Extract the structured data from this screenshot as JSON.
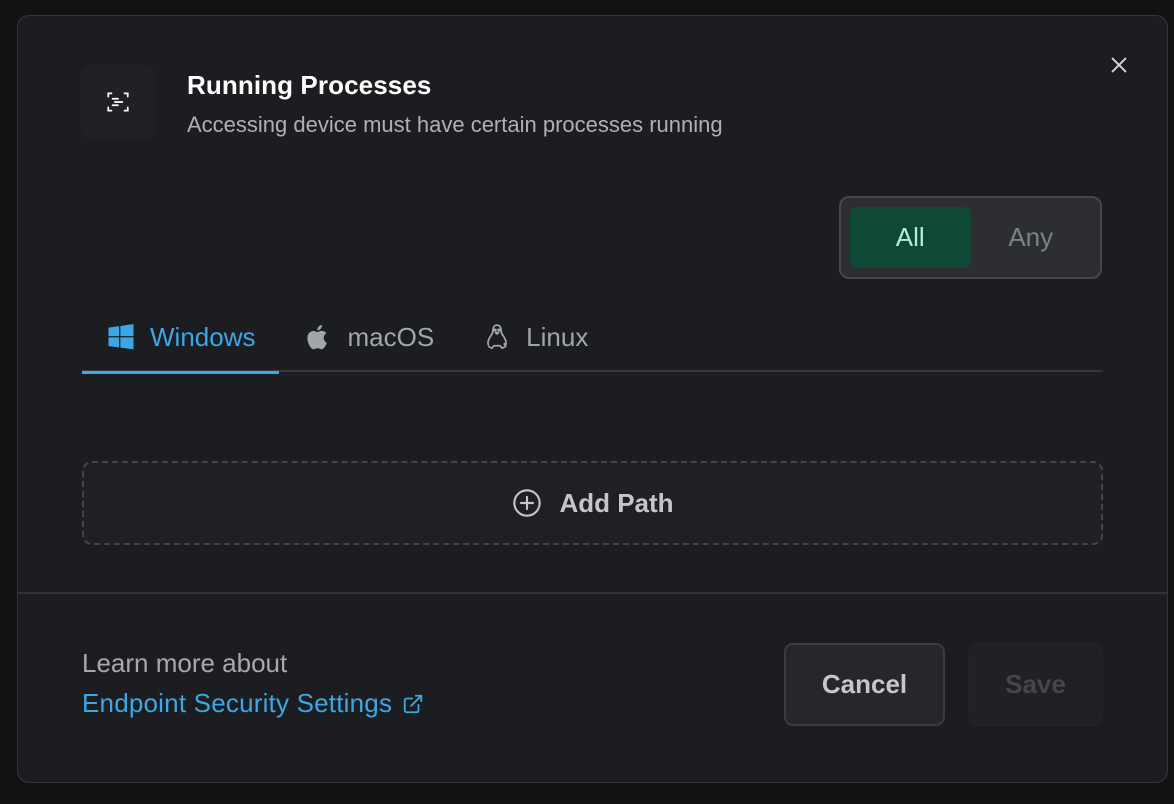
{
  "header": {
    "icon": "process-scan-icon",
    "title": "Running Processes",
    "subtitle": "Accessing device must have certain processes running"
  },
  "match_mode": {
    "options": [
      {
        "label": "All",
        "active": true
      },
      {
        "label": "Any",
        "active": false
      }
    ]
  },
  "tabs": [
    {
      "label": "Windows",
      "icon": "windows-icon",
      "active": true
    },
    {
      "label": "macOS",
      "icon": "apple-icon",
      "active": false
    },
    {
      "label": "Linux",
      "icon": "linux-icon",
      "active": false
    }
  ],
  "add_path": {
    "label": "Add Path",
    "icon": "plus-circle-icon"
  },
  "footer": {
    "learn_text": "Learn more about",
    "link_text": "Endpoint Security Settings",
    "cancel_label": "Cancel",
    "save_label": "Save"
  },
  "colors": {
    "accent": "#3ba7e6",
    "active_toggle_bg": "#104836",
    "active_toggle_text": "#b8ecd5"
  }
}
